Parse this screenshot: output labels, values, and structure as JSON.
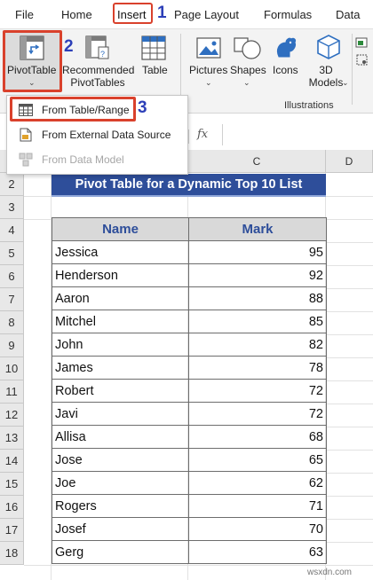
{
  "menu": {
    "tabs": [
      "File",
      "Home",
      "Insert",
      "Page Layout",
      "Formulas",
      "Data"
    ],
    "annotation_1": "1"
  },
  "ribbon": {
    "pivot_table": {
      "label": "PivotTable",
      "annotation": "2"
    },
    "recommended": {
      "line1": "Recommended",
      "line2": "PivotTables"
    },
    "table": {
      "label": "Table"
    },
    "pictures": {
      "label": "Pictures"
    },
    "shapes": {
      "label": "Shapes"
    },
    "icons": {
      "label": "Icons"
    },
    "models_3d": {
      "line1": "3D",
      "line2": "Models"
    },
    "illustrations_group": "Illustrations"
  },
  "dropdown": {
    "items": [
      {
        "label": "From Table/Range",
        "enabled": true
      },
      {
        "label": "From External Data Source",
        "enabled": true
      },
      {
        "label": "From Data Model",
        "enabled": false
      }
    ],
    "annotation": "3"
  },
  "formula_bar": {
    "fx": "fx"
  },
  "sheet": {
    "columns": [
      "C",
      "D"
    ],
    "rows": [
      "2",
      "3",
      "4",
      "5",
      "6",
      "7",
      "8",
      "9",
      "10",
      "11",
      "12",
      "13",
      "14",
      "15",
      "16",
      "17",
      "18"
    ],
    "title": "Pivot Table for a Dynamic Top 10 List",
    "headers": {
      "name": "Name",
      "mark": "Mark"
    },
    "records": [
      {
        "name": "Jessica",
        "mark": "95"
      },
      {
        "name": "Henderson",
        "mark": "92"
      },
      {
        "name": "Aaron",
        "mark": "88"
      },
      {
        "name": "Mitchel",
        "mark": "85"
      },
      {
        "name": "John",
        "mark": "82"
      },
      {
        "name": "James",
        "mark": "78"
      },
      {
        "name": "Robert",
        "mark": "72"
      },
      {
        "name": "Javi",
        "mark": "72"
      },
      {
        "name": "Allisa",
        "mark": "68"
      },
      {
        "name": "Jose",
        "mark": "65"
      },
      {
        "name": "Joe",
        "mark": "62"
      },
      {
        "name": "Rogers",
        "mark": "71"
      },
      {
        "name": "Josef",
        "mark": "70"
      },
      {
        "name": "Gerg",
        "mark": "63"
      }
    ]
  },
  "watermark": "wsxdn.com",
  "colors": {
    "accent_red": "#d9412c",
    "annotation_blue": "#2c3fb8",
    "title_bg": "#2e4e9a"
  }
}
